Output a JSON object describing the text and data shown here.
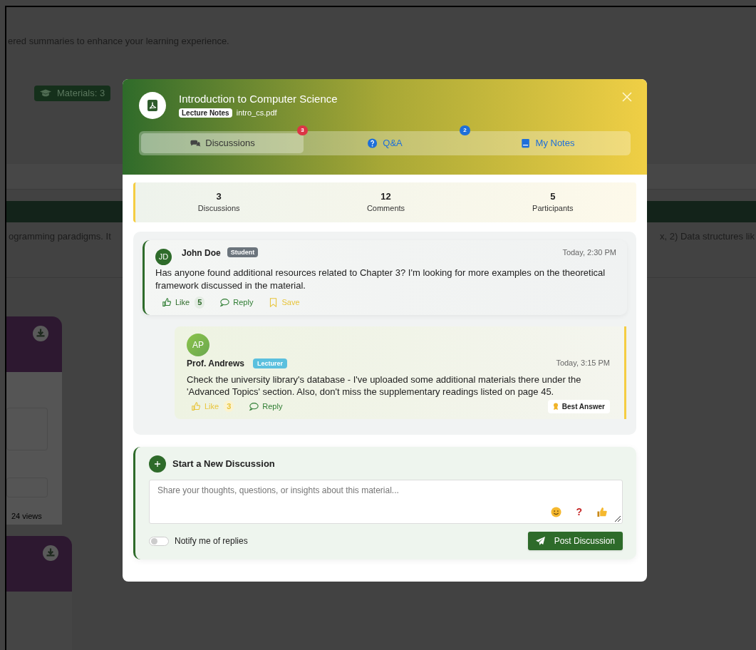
{
  "background": {
    "intro_text": "ered summaries to enhance your learning experience.",
    "materials_badge": "Materials: 3",
    "description_left": "ogramming paradigms. It",
    "description_right": "x, 2) Data structures lik",
    "card_views": "24 views"
  },
  "modal": {
    "title": "Introduction to Computer Science",
    "category": "Lecture Notes",
    "filename": "intro_cs.pdf",
    "tabs": [
      {
        "label": "Discussions",
        "kind": "chat",
        "badge": "3",
        "selected": true
      },
      {
        "label": "Q&A",
        "kind": "question",
        "badge": "2",
        "selected": false
      },
      {
        "label": "My Notes",
        "kind": "notes",
        "selected": false
      }
    ],
    "stats": [
      {
        "value": "3",
        "label": "Discussions"
      },
      {
        "value": "12",
        "label": "Comments"
      },
      {
        "value": "5",
        "label": "Participants"
      }
    ],
    "posts": [
      {
        "initials": "JD",
        "author": "John Doe",
        "role": {
          "label": "Student",
          "kind": "student"
        },
        "time": "Today, 2:30 PM",
        "text": "Has anyone found additional resources related to Chapter 3? I'm looking for more examples on the theoretical framework discussed in the material.",
        "actions": [
          {
            "kind": "like",
            "label": "Like",
            "count": "5",
            "active": false
          },
          {
            "kind": "reply",
            "label": "Reply",
            "active": false
          },
          {
            "kind": "save",
            "label": "Save",
            "active": true
          }
        ],
        "replies": [
          {
            "initials": "AP",
            "author": "Prof. Andrews",
            "role": {
              "label": "Lecturer",
              "kind": "lecturer"
            },
            "time": "Today, 3:15 PM",
            "text": "Check the university library's database - I've uploaded some additional materials there under the 'Advanced Topics' section. Also, don't miss the supplementary readings listed on page 45.",
            "best_answer": "Best Answer",
            "actions": [
              {
                "kind": "like",
                "label": "Like",
                "count": "3",
                "active": true
              },
              {
                "kind": "reply",
                "label": "Reply",
                "active": false
              }
            ]
          }
        ]
      }
    ],
    "new_discussion": {
      "title": "Start a New Discussion",
      "placeholder": "Share your thoughts, questions, or insights about this material...",
      "quick_buttons": [
        {
          "kind": "emoji"
        },
        {
          "kind": "question",
          "text": "?"
        },
        {
          "kind": "thumb"
        }
      ],
      "notify_label": "Notify me of replies",
      "notify_on": false,
      "submit": "Post Discussion"
    }
  }
}
